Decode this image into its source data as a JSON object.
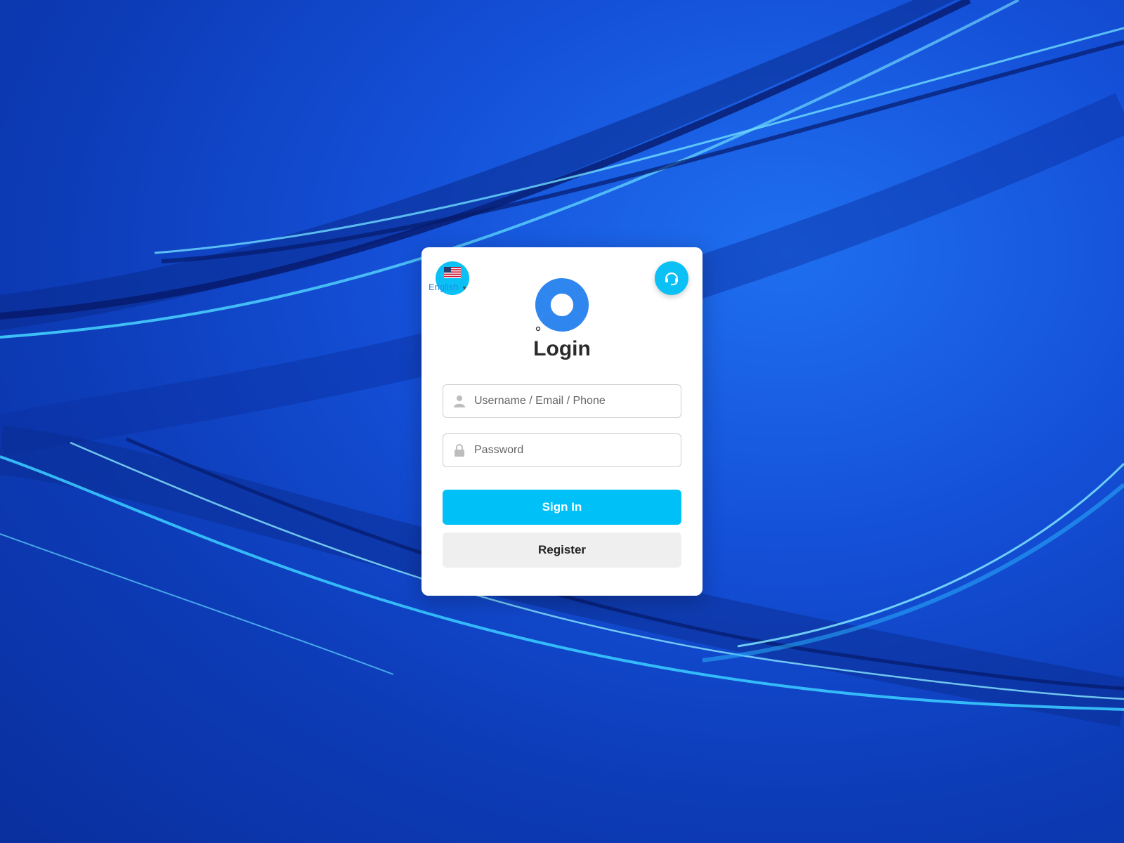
{
  "language": {
    "label": "English",
    "caret": "▼",
    "flag_icon": "us-flag-icon"
  },
  "support": {
    "icon": "headset-icon"
  },
  "login": {
    "title": "Login",
    "username_placeholder": "Username / Email / Phone",
    "username_value": "",
    "password_placeholder": "Password",
    "password_value": "",
    "signin_label": "Sign In",
    "register_label": "Register"
  },
  "colors": {
    "accent": "#00c0f8",
    "icon_button": "#0bc0f5",
    "secondary_button": "#efefef",
    "title_text": "#2b2b2b",
    "logo_blue": "#2f86ef"
  }
}
